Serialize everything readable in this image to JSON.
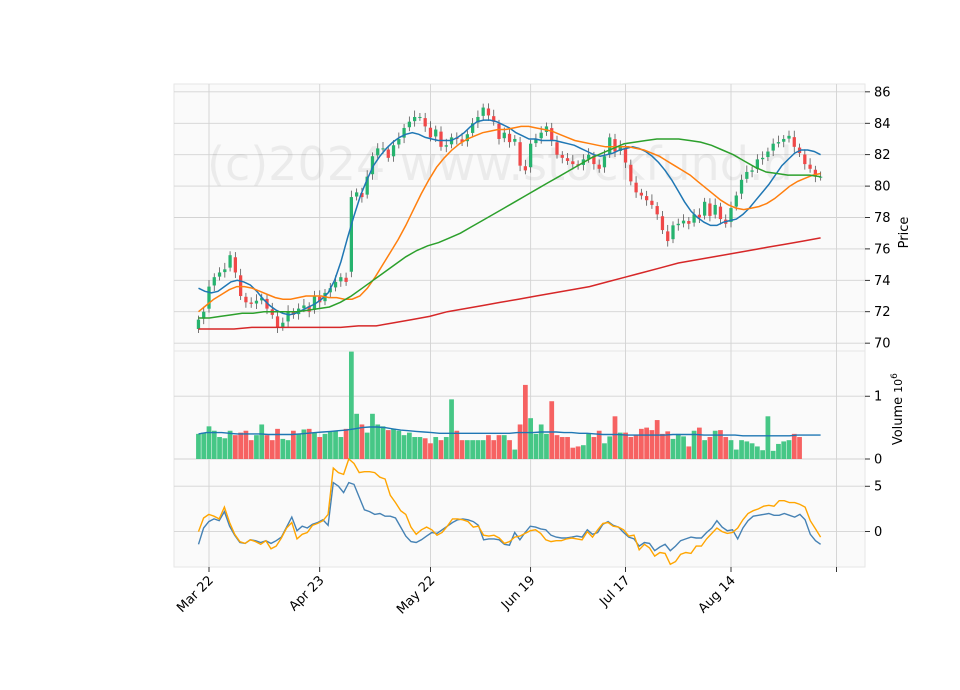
{
  "watermark": "(c)2024 www.stockfund.d",
  "chart_data": {
    "type": "candlestick",
    "x": [
      "2024-03-20",
      "2024-03-21",
      "2024-03-22",
      "2024-03-25",
      "2024-03-26",
      "2024-03-27",
      "2024-03-28",
      "2024-04-01",
      "2024-04-02",
      "2024-04-03",
      "2024-04-04",
      "2024-04-05",
      "2024-04-08",
      "2024-04-09",
      "2024-04-10",
      "2024-04-11",
      "2024-04-12",
      "2024-04-15",
      "2024-04-16",
      "2024-04-17",
      "2024-04-18",
      "2024-04-19",
      "2024-04-22",
      "2024-04-23",
      "2024-04-24",
      "2024-04-25",
      "2024-04-26",
      "2024-04-29",
      "2024-04-30",
      "2024-05-01",
      "2024-05-02",
      "2024-05-03",
      "2024-05-06",
      "2024-05-07",
      "2024-05-08",
      "2024-05-09",
      "2024-05-10",
      "2024-05-13",
      "2024-05-14",
      "2024-05-15",
      "2024-05-16",
      "2024-05-17",
      "2024-05-20",
      "2024-05-21",
      "2024-05-22",
      "2024-05-23",
      "2024-05-24",
      "2024-05-28",
      "2024-05-29",
      "2024-05-30",
      "2024-05-31",
      "2024-06-03",
      "2024-06-04",
      "2024-06-05",
      "2024-06-06",
      "2024-06-07",
      "2024-06-10",
      "2024-06-11",
      "2024-06-12",
      "2024-06-13",
      "2024-06-14",
      "2024-06-17",
      "2024-06-18",
      "2024-06-20",
      "2024-06-21",
      "2024-06-24",
      "2024-06-25",
      "2024-06-26",
      "2024-06-27",
      "2024-06-28",
      "2024-07-01",
      "2024-07-02",
      "2024-07-03",
      "2024-07-05",
      "2024-07-08",
      "2024-07-09",
      "2024-07-10",
      "2024-07-11",
      "2024-07-12",
      "2024-07-15",
      "2024-07-16",
      "2024-07-17",
      "2024-07-18",
      "2024-07-19",
      "2024-07-22",
      "2024-07-23",
      "2024-07-24",
      "2024-07-25",
      "2024-07-26",
      "2024-07-29",
      "2024-07-30",
      "2024-07-31",
      "2024-08-01",
      "2024-08-02",
      "2024-08-05",
      "2024-08-06",
      "2024-08-07",
      "2024-08-08",
      "2024-08-09",
      "2024-08-12",
      "2024-08-13",
      "2024-08-14",
      "2024-08-15",
      "2024-08-16",
      "2024-08-19",
      "2024-08-20",
      "2024-08-21",
      "2024-08-22",
      "2024-08-23",
      "2024-08-26",
      "2024-08-27",
      "2024-08-28",
      "2024-08-29",
      "2024-08-30",
      "2024-09-03",
      "2024-09-04",
      "2024-09-05",
      "2024-09-06",
      "2024-09-09"
    ],
    "x_tick_labels": [
      "Mar 22",
      "Apr 23",
      "May 22",
      "Jun 19",
      "Jul 17",
      "Aug 14"
    ],
    "x_tick_dates": [
      "2024-03-22",
      "2024-04-23",
      "2024-05-22",
      "2024-06-20",
      "2024-07-17",
      "2024-08-14"
    ],
    "price": {
      "ylabel": "Price",
      "ylim": [
        69.5,
        86.5
      ],
      "yticks": [
        70,
        72,
        74,
        76,
        78,
        80,
        82,
        84,
        86
      ],
      "close": [
        71.5,
        72.0,
        73.6,
        74.2,
        74.5,
        74.7,
        75.6,
        74.5,
        73.0,
        72.6,
        72.5,
        72.7,
        72.9,
        72.2,
        71.8,
        71.0,
        71.3,
        72.0,
        71.8,
        72.2,
        72.4,
        72.0,
        73.0,
        72.6,
        73.2,
        73.5,
        73.9,
        74.2,
        73.9,
        79.3,
        79.6,
        79.3,
        80.6,
        81.9,
        82.4,
        82.4,
        81.8,
        82.6,
        83.0,
        83.7,
        84.1,
        84.4,
        84.4,
        83.8,
        83.1,
        83.6,
        82.5,
        82.6,
        83.1,
        83.0,
        82.8,
        83.3,
        84.0,
        84.4,
        85.0,
        84.5,
        84.1,
        83.0,
        83.4,
        82.8,
        83.0,
        81.3,
        81.0,
        82.7,
        83.0,
        83.4,
        83.8,
        82.9,
        82.0,
        81.8,
        81.6,
        81.4,
        81.3,
        81.7,
        82.0,
        81.4,
        81.1,
        81.9,
        83.1,
        82.2,
        82.5,
        81.5,
        80.3,
        79.6,
        79.4,
        79.1,
        78.8,
        78.2,
        77.2,
        76.5,
        77.5,
        77.6,
        77.8,
        77.6,
        78.2,
        78.0,
        79.0,
        78.1,
        78.8,
        77.9,
        77.6,
        78.6,
        79.4,
        80.4,
        80.9,
        81.0,
        81.7,
        81.8,
        82.2,
        82.7,
        82.8,
        83.0,
        83.2,
        82.5,
        82.1,
        81.4,
        81.1,
        80.6,
        80.6
      ],
      "series": [
        {
          "name": "",
          "color": "#1f77b4",
          "values": [
            73.5,
            73.3,
            73.2,
            73.3,
            73.6,
            73.9,
            74.0,
            73.9,
            73.7,
            73.3,
            72.8,
            72.4,
            72.1,
            71.9,
            71.8,
            71.9,
            72.1,
            72.3,
            72.5,
            72.8,
            73.2,
            74.0,
            75.2,
            76.7,
            78.1,
            79.4,
            80.4,
            81.3,
            81.9,
            82.4,
            82.8,
            83.1,
            83.3,
            83.4,
            83.3,
            83.1,
            83.0,
            82.9,
            82.9,
            82.9,
            83.1,
            83.4,
            83.8,
            84.1,
            84.2,
            84.2,
            84.1,
            83.9,
            83.7,
            83.4,
            83.2,
            83.0,
            83.0,
            82.9,
            82.9,
            82.9,
            82.8,
            82.7,
            82.6,
            82.4,
            82.2,
            82.0,
            81.9,
            82.0,
            82.1,
            82.3,
            82.4,
            82.5,
            82.4,
            82.2,
            81.9,
            81.5,
            81.0,
            80.4,
            79.7,
            79.0,
            78.4,
            78.0,
            77.7,
            77.5,
            77.5,
            77.7,
            77.8,
            77.9,
            78.2,
            78.6,
            79.1,
            79.6,
            80.1,
            80.7,
            81.3,
            81.7,
            82.1,
            82.3,
            82.3,
            82.2,
            82.0
          ]
        },
        {
          "name": "",
          "color": "#ff7f0e",
          "values": [
            72.0,
            72.4,
            72.8,
            73.1,
            73.4,
            73.6,
            73.6,
            73.5,
            73.3,
            73.1,
            72.9,
            72.8,
            72.8,
            72.9,
            73.0,
            73.0,
            73.0,
            72.9,
            72.9,
            72.8,
            72.8,
            73.0,
            73.5,
            74.2,
            75.0,
            75.8,
            76.6,
            77.5,
            78.5,
            79.5,
            80.4,
            81.2,
            81.8,
            82.3,
            82.7,
            83.0,
            83.2,
            83.4,
            83.5,
            83.6,
            83.6,
            83.7,
            83.8,
            83.8,
            83.7,
            83.6,
            83.5,
            83.3,
            83.1,
            82.9,
            82.8,
            82.7,
            82.6,
            82.5,
            82.5,
            82.5,
            82.5,
            82.4,
            82.3,
            82.1,
            81.9,
            81.6,
            81.3,
            81.0,
            80.7,
            80.3,
            79.9,
            79.5,
            79.1,
            78.8,
            78.6,
            78.5,
            78.6,
            78.7,
            78.9,
            79.2,
            79.6,
            80.0,
            80.3,
            80.5,
            80.7,
            80.8
          ]
        },
        {
          "name": "",
          "color": "#2ca02c",
          "values": [
            71.6,
            71.6,
            71.7,
            71.8,
            71.9,
            71.9,
            72.0,
            72.0,
            72.0,
            72.0,
            72.1,
            72.2,
            72.3,
            72.6,
            73.0,
            73.5,
            74.0,
            74.5,
            75.0,
            75.5,
            75.9,
            76.2,
            76.4,
            76.7,
            77.0,
            77.4,
            77.8,
            78.2,
            78.6,
            79.0,
            79.4,
            79.8,
            80.2,
            80.6,
            81.0,
            81.4,
            81.8,
            82.1,
            82.4,
            82.7,
            82.8,
            82.9,
            83.0,
            83.0,
            83.0,
            82.9,
            82.8,
            82.6,
            82.3,
            82.0,
            81.6,
            81.2,
            80.9,
            80.8,
            80.7,
            80.7,
            80.7,
            80.6
          ]
        },
        {
          "name": "",
          "color": "#d62728",
          "values": [
            70.9,
            70.9,
            70.9,
            71.0,
            71.0,
            71.0,
            71.0,
            71.0,
            71.0,
            71.1,
            71.1,
            71.3,
            71.5,
            71.7,
            72.0,
            72.2,
            72.4,
            72.6,
            72.8,
            73.0,
            73.2,
            73.4,
            73.6,
            73.9,
            74.2,
            74.5,
            74.8,
            75.1,
            75.3,
            75.5,
            75.7,
            75.9,
            76.1,
            76.3,
            76.5,
            76.7
          ]
        }
      ]
    },
    "volume": {
      "ylabel": "Volume",
      "unit_exponent": "6",
      "ylim": [
        0,
        1.72
      ],
      "yticks": [
        0,
        1
      ],
      "values": [
        0.4,
        0.42,
        0.52,
        0.45,
        0.35,
        0.33,
        0.45,
        0.38,
        0.42,
        0.45,
        0.3,
        0.38,
        0.55,
        0.38,
        0.3,
        0.48,
        0.32,
        0.3,
        0.45,
        0.4,
        0.47,
        0.48,
        0.42,
        0.35,
        0.4,
        0.43,
        0.45,
        0.35,
        0.48,
        1.71,
        0.72,
        0.55,
        0.42,
        0.72,
        0.55,
        0.52,
        0.46,
        0.48,
        0.45,
        0.38,
        0.42,
        0.35,
        0.35,
        0.33,
        0.25,
        0.35,
        0.3,
        0.35,
        0.95,
        0.45,
        0.3,
        0.3,
        0.3,
        0.3,
        0.3,
        0.38,
        0.3,
        0.38,
        0.38,
        0.3,
        0.15,
        0.55,
        1.18,
        0.65,
        0.4,
        0.55,
        0.4,
        0.92,
        0.38,
        0.35,
        0.35,
        0.18,
        0.2,
        0.22,
        0.4,
        0.35,
        0.45,
        0.25,
        0.36,
        0.68,
        0.42,
        0.42,
        0.35,
        0.38,
        0.48,
        0.5,
        0.46,
        0.62,
        0.4,
        0.44,
        0.32,
        0.4,
        0.36,
        0.2,
        0.45,
        0.5,
        0.3,
        0.35,
        0.45,
        0.46,
        0.35,
        0.3,
        0.15,
        0.3,
        0.28,
        0.25,
        0.2,
        0.14,
        0.68,
        0.13,
        0.24,
        0.28,
        0.3,
        0.4,
        0.35
      ],
      "ma": [
        0.4,
        0.42,
        0.42,
        0.42,
        0.41,
        0.4,
        0.4,
        0.4,
        0.4,
        0.39,
        0.39,
        0.39,
        0.39,
        0.4,
        0.41,
        0.42,
        0.43,
        0.44,
        0.45,
        0.46,
        0.48,
        0.5,
        0.51,
        0.51,
        0.5,
        0.48,
        0.46,
        0.45,
        0.44,
        0.43,
        0.42,
        0.41,
        0.41,
        0.41,
        0.41,
        0.41,
        0.41,
        0.41,
        0.41,
        0.41,
        0.41,
        0.42,
        0.42,
        0.42,
        0.43,
        0.43,
        0.43,
        0.42,
        0.42,
        0.41,
        0.41,
        0.4,
        0.39,
        0.39,
        0.39,
        0.38,
        0.38,
        0.38,
        0.38,
        0.38,
        0.38,
        0.39,
        0.39,
        0.39,
        0.39,
        0.38,
        0.38,
        0.38,
        0.38,
        0.38,
        0.37,
        0.37,
        0.37,
        0.37,
        0.37,
        0.37,
        0.37,
        0.38,
        0.38,
        0.38,
        0.38
      ]
    },
    "oscillator": {
      "ylim": [
        -3.9,
        8.0
      ],
      "yticks": [
        0,
        5
      ],
      "series": [
        {
          "name": "",
          "color": "#4682b4",
          "values": [
            -1.4,
            0.4,
            1.1,
            1.4,
            1.2,
            2.2,
            0.6,
            -0.4,
            -1.2,
            -1.3,
            -0.9,
            -1.0,
            -1.2,
            -1.0,
            -1.3,
            -1.0,
            -0.6,
            0.5,
            1.6,
            0.1,
            0.6,
            0.4,
            0.8,
            1.0,
            1.3,
            0.7,
            5.4,
            5.0,
            4.3,
            5.4,
            5.2,
            3.8,
            2.4,
            2.2,
            1.9,
            2.0,
            1.7,
            1.7,
            1.5,
            0.5,
            -0.5,
            -1.1,
            -1.2,
            -0.9,
            -0.5,
            -0.1,
            -0.2,
            0.2,
            0.6,
            1.0,
            1.3,
            1.4,
            1.3,
            1.1,
            0.7,
            -0.9,
            -0.8,
            -0.8,
            -0.9,
            -1.4,
            -1.5,
            -0.1,
            -0.9,
            -0.1,
            0.6,
            0.5,
            0.3,
            0.2,
            -0.4,
            -0.6,
            -0.7,
            -0.7,
            -0.6,
            -0.5,
            -0.6,
            0.2,
            -0.3,
            -0.1,
            0.8,
            1.1,
            0.7,
            0.5,
            -0.1,
            -0.6,
            -0.8,
            -1.6,
            -1.2,
            -1.3,
            -2.1,
            -1.7,
            -1.4,
            -2.1,
            -1.6,
            -1.0,
            -0.8,
            -0.6,
            -0.7,
            -0.7,
            -0.1,
            0.4,
            1.2,
            0.5,
            0.1,
            0.2,
            -0.8,
            0.4,
            1.2,
            1.7,
            1.8,
            1.9,
            2.0,
            1.8,
            1.8,
            2.0,
            1.8,
            1.6,
            1.9,
            1.3,
            -0.3,
            -1.0,
            -1.4
          ]
        },
        {
          "name": "",
          "color": "#ffa500",
          "values": [
            0.0,
            1.5,
            1.9,
            1.7,
            1.4,
            2.7,
            1.0,
            -0.3,
            -1.1,
            -1.3,
            -0.9,
            -1.1,
            -1.4,
            -1.0,
            -1.9,
            -1.6,
            -0.7,
            0.4,
            1.0,
            -0.8,
            -0.3,
            -0.1,
            0.7,
            0.9,
            1.2,
            1.9,
            7.0,
            6.5,
            6.3,
            8.0,
            7.5,
            6.5,
            6.6,
            6.6,
            6.5,
            6.0,
            5.8,
            4.0,
            3.2,
            2.3,
            1.9,
            0.5,
            -0.3,
            0.2,
            0.5,
            0.2,
            -0.4,
            -0.1,
            0.6,
            1.4,
            1.4,
            1.3,
            1.1,
            0.5,
            0.6,
            -0.4,
            -0.5,
            -0.4,
            -0.7,
            -1.3,
            -1.1,
            -0.6,
            -0.5,
            -0.2,
            0.1,
            0.2,
            -0.2,
            -0.9,
            -1.1,
            -1.0,
            -1.0,
            -0.8,
            -0.7,
            -0.8,
            -0.9,
            0.0,
            -0.6,
            0.2,
            0.9,
            1.0,
            0.6,
            0.5,
            0.2,
            -0.5,
            -0.4,
            -2.0,
            -1.4,
            -1.8,
            -2.7,
            -2.3,
            -2.4,
            -3.6,
            -3.3,
            -2.5,
            -2.3,
            -2.4,
            -1.6,
            -1.6,
            -0.8,
            -0.2,
            0.4,
            0.0,
            -0.2,
            -0.1,
            0.4,
            1.3,
            2.0,
            2.3,
            2.5,
            2.8,
            2.9,
            2.8,
            3.4,
            3.4,
            3.2,
            3.2,
            3.0,
            2.7,
            1.2,
            0.3,
            -0.6
          ]
        }
      ]
    }
  }
}
